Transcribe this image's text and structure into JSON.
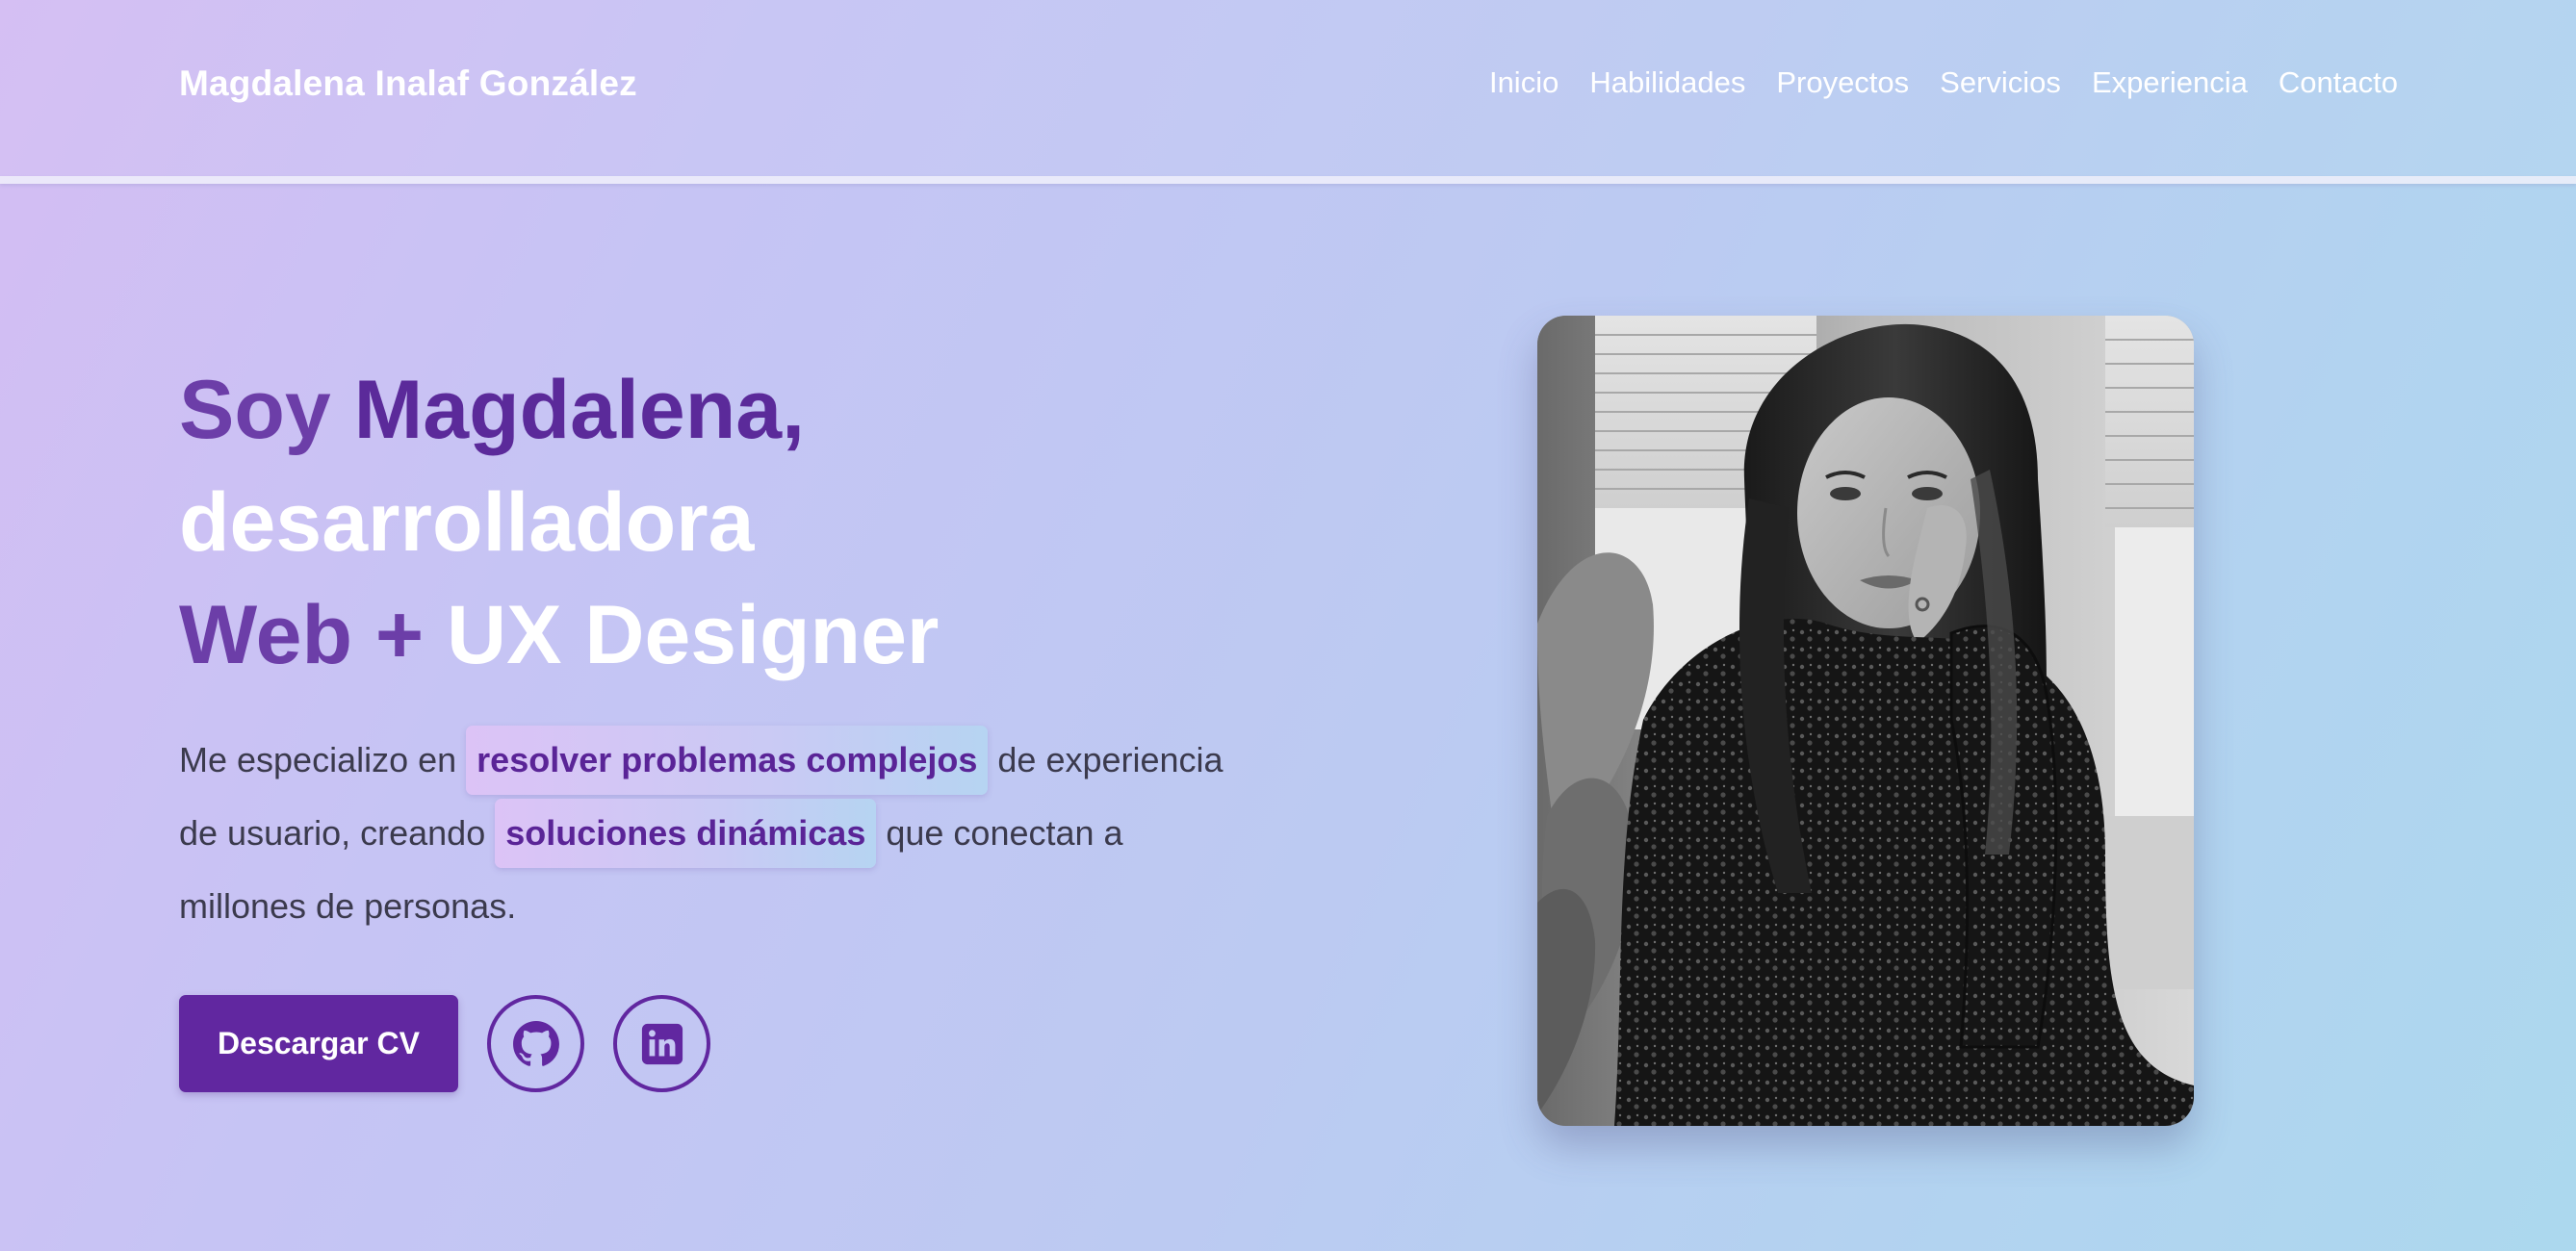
{
  "header": {
    "brand": "Magdalena Inalaf González",
    "nav": [
      "Inicio",
      "Habilidades",
      "Proyectos",
      "Servicios",
      "Experiencia",
      "Contacto"
    ]
  },
  "hero": {
    "title": {
      "line1_a": "Soy ",
      "line1_b": "Magdalena,",
      "line2": "desarrolladora",
      "line3_a": "Web + ",
      "line3_b": "UX Designer"
    },
    "lead": {
      "t1": "Me especializo en ",
      "chip1": "resolver problemas complejos",
      "t2": " de experiencia de usuario, creando ",
      "chip2": "soluciones dinámicas",
      "t3": " que conectan a millones de personas."
    },
    "cv_button": "Descargar CV",
    "social": {
      "github_icon": "github-icon",
      "linkedin_icon": "linkedin-icon"
    }
  },
  "colors": {
    "accent": "#6127a0",
    "accent_text": "#5a2497",
    "body_text": "#3b3a4d"
  }
}
